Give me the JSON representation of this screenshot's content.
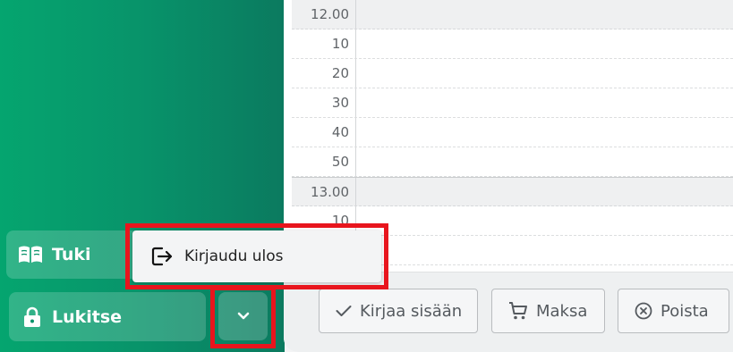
{
  "sidebar": {
    "support_label": "Tuki",
    "lock_label": "Lukitse"
  },
  "menu": {
    "logout_label": "Kirjaudu ulos"
  },
  "schedule": {
    "rows": [
      {
        "label": "12.00",
        "hour": true
      },
      {
        "label": "10",
        "hour": false
      },
      {
        "label": "20",
        "hour": false
      },
      {
        "label": "30",
        "hour": false
      },
      {
        "label": "40",
        "hour": false
      },
      {
        "label": "50",
        "hour": false
      },
      {
        "label": "13.00",
        "hour": true
      },
      {
        "label": "10",
        "hour": false
      },
      {
        "label": "",
        "hour": false
      }
    ]
  },
  "actions": {
    "checkin_label": "Kirjaa sisään",
    "pay_label": "Maksa",
    "delete_label": "Poista"
  },
  "icons": {
    "support": "book-icon",
    "lock": "lock-icon",
    "menu_toggle": "chevron-down-icon",
    "logout": "logout-icon",
    "checkin": "check-icon",
    "pay": "cart-icon",
    "delete": "close-circle-icon"
  }
}
